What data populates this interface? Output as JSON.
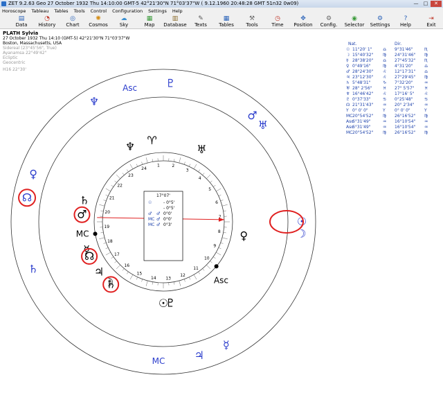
{
  "window": {
    "title": "ZET 9.2.63 Geo   27 October 1932  Thu   14:10:00 GMT-5 42°21'30\"N  71°03'37\"W   ( 9.12.1960  20:48:28 GMT 51n32 0w09)",
    "minimize": "—",
    "maximize": "□",
    "close": "✕"
  },
  "menu": [
    "Horoscope",
    "Tableau",
    "Tables",
    "Tools",
    "Control",
    "Configuration",
    "Settings",
    "Help"
  ],
  "toolbar": [
    {
      "label": "Data",
      "icon": "data-icon",
      "glyph": "▤",
      "color": "#2a62b8"
    },
    {
      "label": "History",
      "icon": "history-icon",
      "glyph": "◔",
      "color": "#c0392b"
    },
    {
      "label": "Chart",
      "icon": "chart-icon",
      "glyph": "◎",
      "color": "#2a62b8"
    },
    {
      "label": "Cosmos",
      "icon": "cosmos-icon",
      "glyph": "✺",
      "color": "#d38b12"
    },
    {
      "label": "Sky",
      "icon": "sky-icon",
      "glyph": "☁",
      "color": "#3a8fd0"
    },
    {
      "label": "Map",
      "icon": "map-icon",
      "glyph": "▦",
      "color": "#3a9a3a"
    },
    {
      "label": "Database",
      "icon": "database-icon",
      "glyph": "▥",
      "color": "#8a6a2a"
    },
    {
      "label": "Texts",
      "icon": "texts-icon",
      "glyph": "✎",
      "color": "#555555"
    },
    {
      "label": "Tables",
      "icon": "tables-icon",
      "glyph": "▦",
      "color": "#2a62b8"
    },
    {
      "label": "Tools",
      "icon": "tools-icon",
      "glyph": "⚒",
      "color": "#666666"
    },
    {
      "label": "Time",
      "icon": "time-icon",
      "glyph": "◷",
      "color": "#c0392b"
    },
    {
      "label": "Position",
      "icon": "position-icon",
      "glyph": "✥",
      "color": "#2a62b8"
    },
    {
      "label": "Config.",
      "icon": "config-icon",
      "glyph": "⚙",
      "color": "#666666"
    },
    {
      "label": "Selector",
      "icon": "selector-icon",
      "glyph": "◉",
      "color": "#3a9a3a"
    },
    {
      "label": "Settings",
      "icon": "settings-icon",
      "glyph": "⚙",
      "color": "#2a62b8"
    },
    {
      "label": "Help",
      "icon": "help-icon",
      "glyph": "?",
      "color": "#2a62b8"
    },
    {
      "label": "Exit",
      "icon": "exit-icon",
      "glyph": "⇥",
      "color": "#c0392b"
    }
  ],
  "info": {
    "name": "PLATH Sylvia",
    "datetime": "27 October 1932  Thu  14:10 (GMT-5) 42°21'30\"N  71°03'37\"W",
    "place": "Boston, Massachusetts, USA",
    "sidereal": "Sidereal (23°45'56\", True)",
    "ayanamsa": "Ayanamsa 22°49'42\"",
    "ecliptic": "Ecliptic",
    "geocentric": "Geocentric",
    "house": "H16  22°30'"
  },
  "aspect_box": {
    "title": "17°07'",
    "rows": [
      {
        "a": "☉",
        "b": "",
        "v": "- 0°5'"
      },
      {
        "a": "",
        "b": "",
        "v": "- 0°5'"
      },
      {
        "a": "♂",
        "b": "♂",
        "v": "0°0'"
      },
      {
        "a": "MC",
        "b": "♂",
        "v": "0°0'"
      },
      {
        "a": "MC",
        "b": "♂",
        "v": "0°3'"
      }
    ]
  },
  "positions": {
    "header_left": "Nat.",
    "header_right": "Dir.",
    "rows": [
      {
        "g": "☉",
        "l": "11°20' 1\"",
        "ls": "♎",
        "r": "9°31'46\"",
        "rs": "♏"
      },
      {
        "g": "☽",
        "l": "15°40'32\"",
        "ls": "♍",
        "r": "24°31'46\"",
        "rs": "♍"
      },
      {
        "g": "☿",
        "l": "28°38'20\"",
        "ls": "♎",
        "r": "27°45'32\"",
        "rs": "♏"
      },
      {
        "g": "♀",
        "l": "0°49'16\"",
        "ls": "♍",
        "r": "4°31'20\"",
        "rs": "♎"
      },
      {
        "g": "♂",
        "l": "28°24'30\"",
        "ls": "♌",
        "r": "12°17'31\"",
        "rs": "♎"
      },
      {
        "g": "♃",
        "l": "23°12'30\"",
        "ls": "♌",
        "r": "27°29'45\"",
        "rs": "♍"
      },
      {
        "g": "♄",
        "l": "5°48'31\"",
        "ls": "♑",
        "r": "7°32'20\"",
        "rs": "♒"
      },
      {
        "g": "♅",
        "l": "28° 2'56\"",
        "ls": "♓",
        "r": "27° 5'57\"",
        "rs": "♓"
      },
      {
        "g": "♆",
        "l": "16°46'42\"",
        "ls": "♌",
        "r": "17°16' 5\"",
        "rs": "♌"
      },
      {
        "g": "♇",
        "l": "0°37'33\"",
        "ls": "♋",
        "r": "0°25'48\"",
        "rs": "♋"
      },
      {
        "g": "☊",
        "l": "21°31'43\"",
        "ls": "♒",
        "r": "20° 2'34\"",
        "rs": "♒"
      },
      {
        "g": "Υ",
        "l": "0° 0' 0\"",
        "ls": "Υ",
        "r": "0° 0' 0\"",
        "rs": "Υ"
      },
      {
        "g": "MC",
        "l": "20°54'52\"",
        "ls": "♍",
        "r": "26°16'52\"",
        "rs": "♍"
      },
      {
        "g": "Asc",
        "l": "6°31'49\"",
        "ls": "♒",
        "r": "16°10'54\"",
        "rs": "♒"
      },
      {
        "g": "Asc",
        "l": "6°31'49\"",
        "ls": "♒",
        "r": "16°10'54\"",
        "rs": "♒"
      },
      {
        "g": "MC",
        "l": "20°54'52\"",
        "ls": "♍",
        "r": "26°16'52\"",
        "rs": "♍"
      }
    ]
  },
  "chart": {
    "house_numbers": [
      "1",
      "2",
      "3",
      "4",
      "5",
      "6",
      "7",
      "8",
      "9",
      "10",
      "11",
      "12",
      "13",
      "14",
      "15",
      "16",
      "17",
      "18",
      "19",
      "20",
      "21",
      "22",
      "23",
      "24"
    ],
    "natal": [
      {
        "name": "saturn-natal",
        "glyph": "♄",
        "deg": 230
      },
      {
        "name": "jupiter-natal",
        "glyph": "♃",
        "deg": 218
      },
      {
        "name": "pluto-natal",
        "glyph": "♇",
        "deg": 275
      },
      {
        "name": "mars-natal",
        "glyph": "♂",
        "deg": 175
      },
      {
        "name": "saturn-symbol-inner",
        "glyph": "♄",
        "deg": 165
      },
      {
        "name": "moon-natal",
        "glyph": "☽",
        "deg": 228
      },
      {
        "name": "mercury-natal",
        "glyph": "☿",
        "deg": 200
      },
      {
        "name": "mc-natal",
        "glyph": "MC",
        "deg": 188
      },
      {
        "name": "node-natal",
        "glyph": "☊",
        "deg": 205
      },
      {
        "name": "sun-natal",
        "glyph": "☉",
        "deg": 270
      },
      {
        "name": "venus-natal",
        "glyph": "♀",
        "deg": 350
      },
      {
        "name": "asc-natal",
        "glyph": "Asc",
        "deg": 315
      },
      {
        "name": "aries-natal",
        "glyph": "♈",
        "deg": 98
      },
      {
        "name": "neptune-natal",
        "glyph": "♆",
        "deg": 114
      },
      {
        "name": "uranus-natal",
        "glyph": "♅",
        "deg": 62
      }
    ],
    "outer": [
      {
        "name": "neptune-dir",
        "glyph": "♆",
        "deg": 120
      },
      {
        "name": "asc-dir",
        "glyph": "Asc",
        "deg": 104
      },
      {
        "name": "pluto-dir",
        "glyph": "♇",
        "deg": 87
      },
      {
        "name": "venus-dir",
        "glyph": "♀",
        "deg": 160
      },
      {
        "name": "node-dir",
        "glyph": "☊",
        "deg": 170
      },
      {
        "name": "saturn-dir",
        "glyph": "♄",
        "deg": 200
      },
      {
        "name": "mars-dir",
        "glyph": "♂",
        "deg": 50
      },
      {
        "name": "uranus-dir",
        "glyph": "♅",
        "deg": 44
      },
      {
        "name": "sun-dir",
        "glyph": "☉",
        "deg": 0
      },
      {
        "name": "moon-dir",
        "glyph": "☽",
        "deg": -5
      },
      {
        "name": "mercury-dir",
        "glyph": "☿",
        "deg": 297
      },
      {
        "name": "jupiter-dir",
        "glyph": "♃",
        "deg": 285
      },
      {
        "name": "mc-dir",
        "glyph": "MC",
        "deg": 268
      }
    ],
    "ring_colors": {
      "outer": "#2a3ccc",
      "inner": "#000000",
      "arrow": "#e02020",
      "highlight": "#e02020"
    }
  }
}
